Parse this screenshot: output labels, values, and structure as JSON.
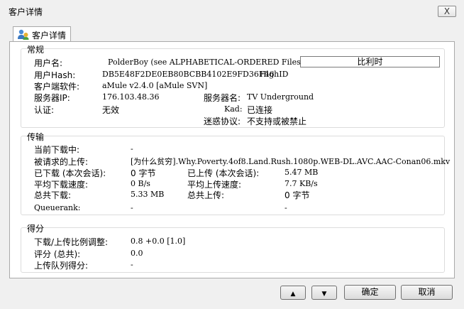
{
  "window": {
    "title": "客户详情",
    "close_label": "X"
  },
  "tab": {
    "label": "客户详情"
  },
  "general": {
    "title": "常规",
    "username_label": "用户名:",
    "username_value": "PolderBoy (see ALPHABETICAL-ORDERED Files)",
    "compare_button": "比利时",
    "userhash_label": "用户Hash:",
    "userhash_value": "DB5E48F2DE0EB80BCBB4102E9FD36F46",
    "highid_value": "HighID",
    "client_label": "客户端软件:",
    "client_value": "aMule v2.4.0 [aMule SVN]",
    "serverip_label": "服务器IP:",
    "serverip_value": "176.103.48.36",
    "servername_label": "服务器名:",
    "servername_value": "TV Underground",
    "auth_label": "认证:",
    "auth_value": "无效",
    "kad_label": "Kad:",
    "kad_value": "已连接",
    "obfuscation_label": "迷惑协议:",
    "obfuscation_value": "不支持或被禁止"
  },
  "transfer": {
    "title": "传输",
    "current_download_label": "当前下载中:",
    "current_download_value": "-",
    "requested_upload_label": "被请求的上传:",
    "requested_upload_value": "[为什么贫穷].Why.Poverty.4of8.Land.Rush.1080p.WEB-DL.AVC.AAC-Conan06.mkv",
    "downloaded_session_label": "已下载 (本次会话):",
    "downloaded_session_value": "0 字节",
    "uploaded_session_label": "已上传 (本次会话):",
    "uploaded_session_value": "5.47 MB",
    "avg_download_label": "平均下载速度:",
    "avg_download_value": "0 B/s",
    "avg_upload_label": "平均上传速度:",
    "avg_upload_value": "7.7 KB/s",
    "total_download_label": "总共下载:",
    "total_download_value": "5.33 MB",
    "total_upload_label": "总共上传:",
    "total_upload_value": "0 字节",
    "queuerank_label": "Queuerank:",
    "queuerank_value": "-",
    "queuerank_value2": "-"
  },
  "score": {
    "title": "得分",
    "ratio_label": "下载/上传比例调整:",
    "ratio_value": "0.8 +0.0 [1.0]",
    "rating_label": "评分 (总共):",
    "rating_value": "0.0",
    "queue_score_label": "上传队列得分:",
    "queue_score_value": "-"
  },
  "buttons": {
    "up_icon": "triangle-up-icon",
    "down_icon": "triangle-down-icon",
    "ok": "确定",
    "cancel": "取消"
  }
}
